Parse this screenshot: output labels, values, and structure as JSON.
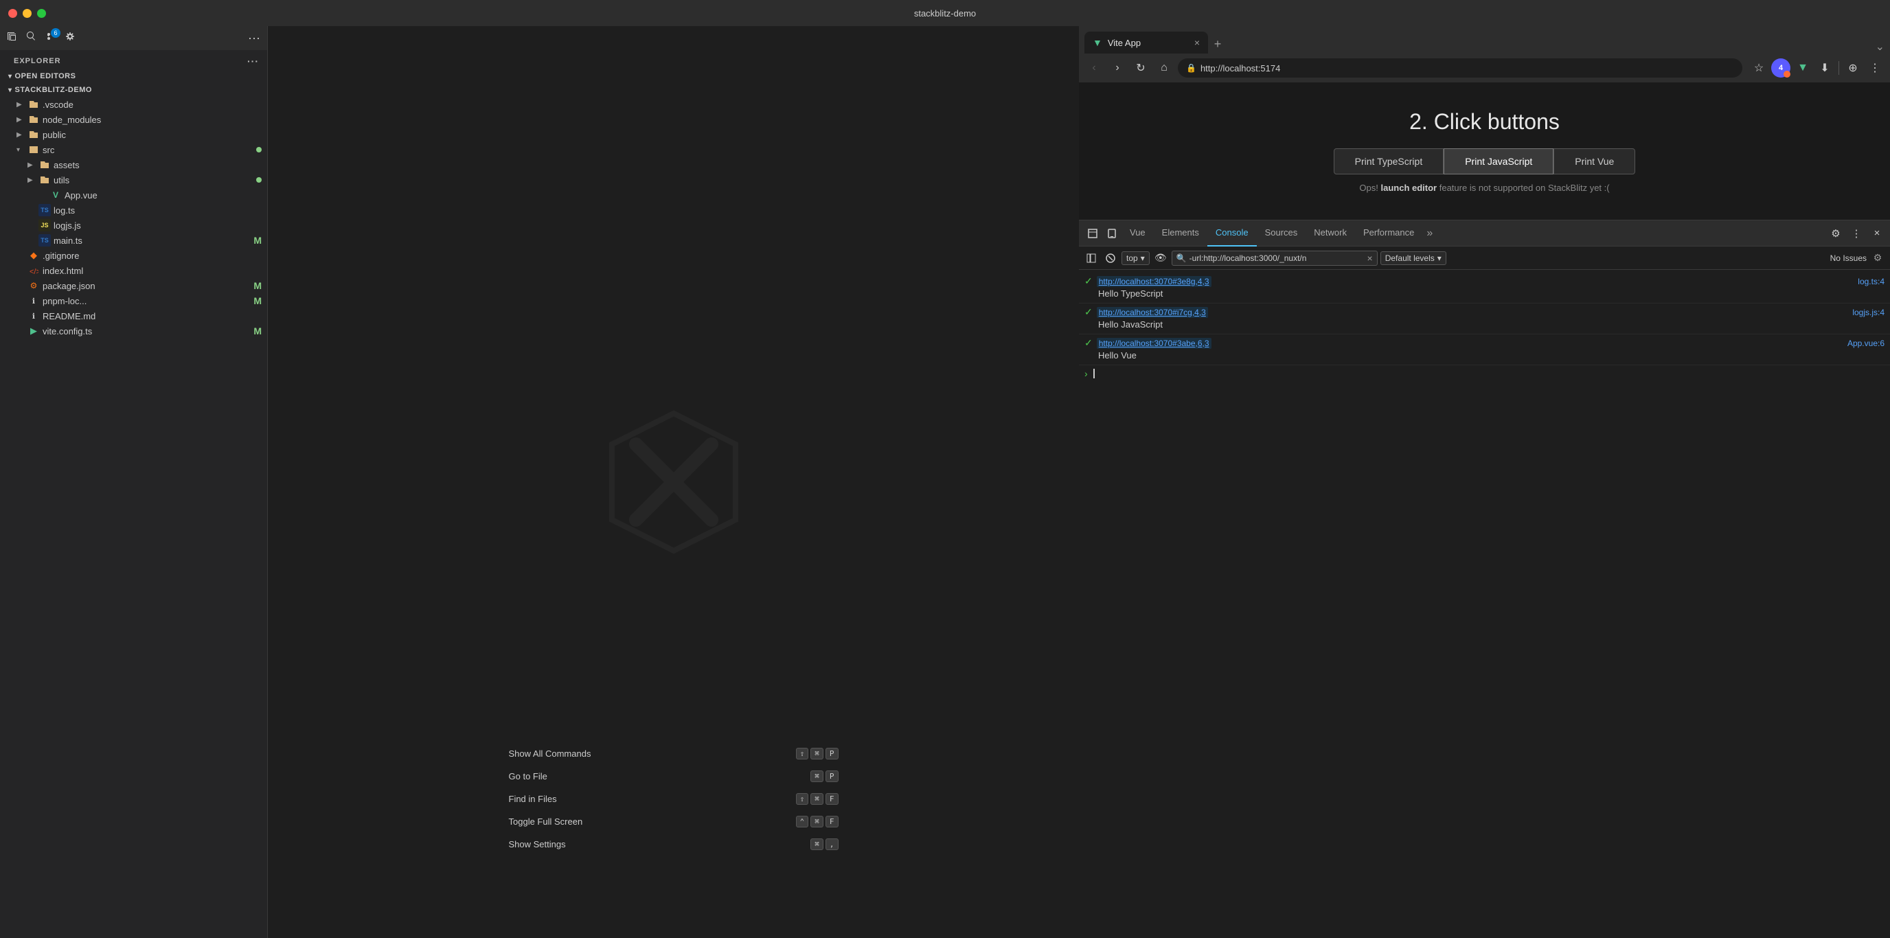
{
  "titleBar": {
    "title": "stackblitz-demo"
  },
  "vscode": {
    "toolbar": {
      "folderIcon": "📁",
      "searchIcon": "🔍",
      "sourceBadge": "6",
      "settingsIcon": "⚙",
      "ellipsisIcon": "···"
    },
    "explorer": {
      "label": "EXPLORER",
      "ellipsis": "···"
    },
    "sections": {
      "openEditors": "OPEN EDITORS",
      "stackblitzDemo": "STACKBLITZ-DEMO"
    },
    "fileTree": [
      {
        "id": "vscode",
        "name": ".vscode",
        "type": "folder",
        "indent": 1,
        "collapsed": true
      },
      {
        "id": "node_modules",
        "name": "node_modules",
        "type": "folder",
        "indent": 1,
        "collapsed": true
      },
      {
        "id": "public",
        "name": "public",
        "type": "folder",
        "indent": 1,
        "collapsed": true
      },
      {
        "id": "src",
        "name": "src",
        "type": "folder",
        "indent": 1,
        "collapsed": false,
        "dot": true
      },
      {
        "id": "assets",
        "name": "assets",
        "type": "folder",
        "indent": 2,
        "collapsed": true
      },
      {
        "id": "utils",
        "name": "utils",
        "type": "folder",
        "indent": 2,
        "collapsed": true,
        "dot": true
      },
      {
        "id": "app_vue",
        "name": "App.vue",
        "type": "vue",
        "indent": 3
      },
      {
        "id": "log_ts",
        "name": "log.ts",
        "type": "ts",
        "indent": 2
      },
      {
        "id": "logjs",
        "name": "logjs.js",
        "type": "js",
        "indent": 2
      },
      {
        "id": "main_ts",
        "name": "main.ts",
        "type": "ts",
        "indent": 2,
        "modified": "M"
      },
      {
        "id": "gitignore",
        "name": ".gitignore",
        "type": "config",
        "indent": 1
      },
      {
        "id": "index_html",
        "name": "index.html",
        "type": "html",
        "indent": 1
      },
      {
        "id": "package_json",
        "name": "package.json",
        "type": "json",
        "indent": 1,
        "modified": "M"
      },
      {
        "id": "pnpm_loc",
        "name": "pnpm-loc...",
        "type": "config",
        "indent": 1,
        "modified": "M"
      },
      {
        "id": "readme",
        "name": "README.md",
        "type": "md",
        "indent": 1
      },
      {
        "id": "vite_config",
        "name": "vite.config.ts",
        "type": "ts",
        "indent": 1,
        "modified": "M"
      }
    ],
    "commands": [
      {
        "label": "Show All Commands",
        "keys": [
          "⇧",
          "⌘",
          "P"
        ]
      },
      {
        "label": "Go to File",
        "keys": [
          "⌘",
          "P"
        ]
      },
      {
        "label": "Find in Files",
        "keys": [
          "⇧",
          "⌘",
          "F"
        ]
      },
      {
        "label": "Toggle Full Screen",
        "keys": [
          "⌃",
          "⌘",
          "F"
        ]
      },
      {
        "label": "Show Settings",
        "keys": [
          "⌘",
          ","
        ]
      }
    ]
  },
  "browser": {
    "tab": {
      "title": "Vite App",
      "favicon": "▼",
      "faviconColor": "#4fc08d"
    },
    "addressBar": {
      "url": "http://localhost:5174",
      "avatarLabel": "4",
      "extensionIcon": "▼"
    },
    "page": {
      "heading": "2. Click buttons",
      "buttons": [
        "Print TypeScript",
        "Print JavaScript",
        "Print Vue"
      ],
      "activeButton": "Print JavaScript",
      "unsupportedMsg": "Ops!",
      "unsupportedBold": "launch editor",
      "unsupportedRest": "feature is not supported on StackBlitz yet :("
    },
    "devtools": {
      "tabs": [
        "Vue",
        "Elements",
        "Console",
        "Sources",
        "Network",
        "Performance"
      ],
      "activeTab": "Console",
      "moreIcon": "»",
      "consoleToolbar": {
        "topLabel": "top",
        "filterValue": "-url:http://localhost:3000/_nuxt/n",
        "defaultLevels": "Default levels",
        "noIssues": "No Issues"
      },
      "consoleEntries": [
        {
          "link": "http://localhost:3070#3e8g,4,3",
          "fileRef": "log.ts:4",
          "message": "Hello TypeScript"
        },
        {
          "link": "http://localhost:3070#i7cg,4,3",
          "fileRef": "logjs.js:4",
          "message": "Hello JavaScript"
        },
        {
          "link": "http://localhost:3070#3abe,6,3",
          "fileRef": "App.vue:6",
          "message": "Hello Vue"
        }
      ]
    }
  }
}
